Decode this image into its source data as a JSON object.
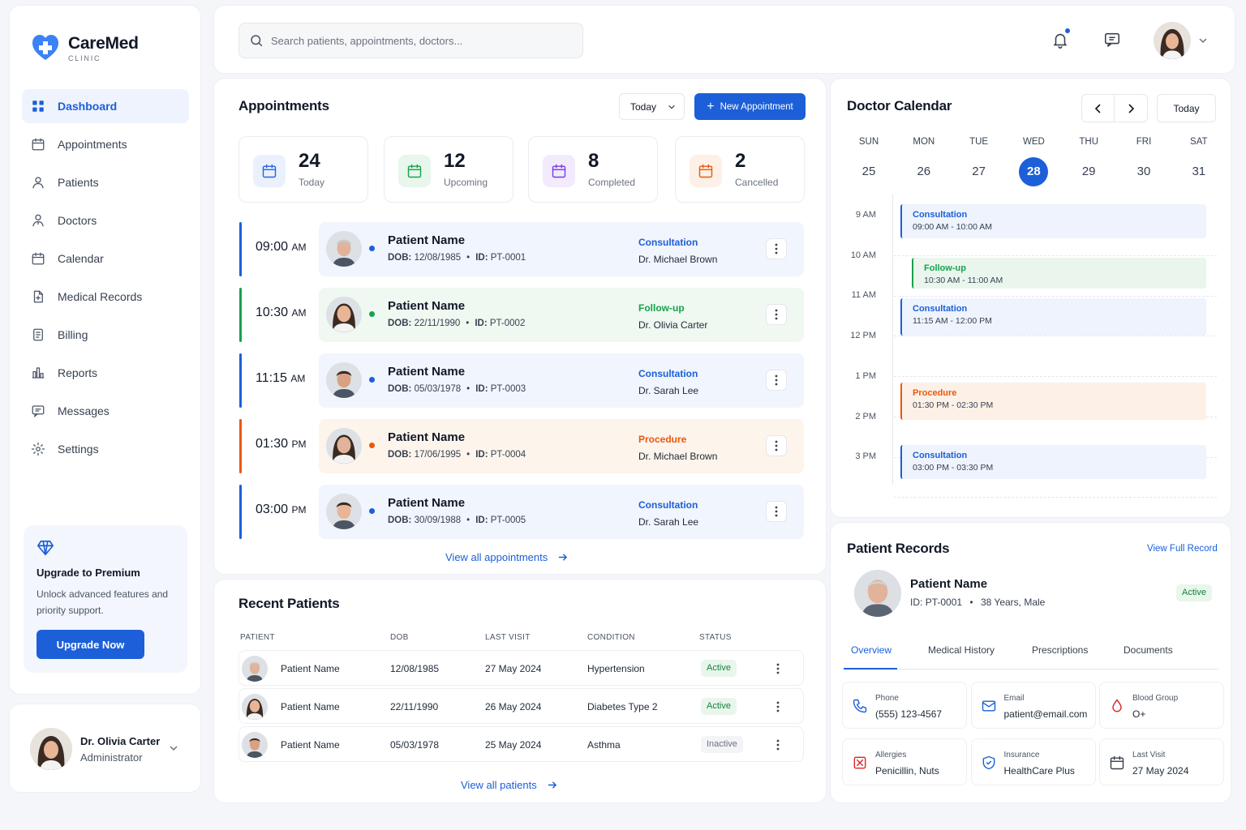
{
  "brand": {
    "name": "CareMed",
    "sub": "CLINIC"
  },
  "nav": [
    {
      "label": "Dashboard",
      "icon": "grid-icon"
    },
    {
      "label": "Appointments",
      "icon": "calendar-icon"
    },
    {
      "label": "Patients",
      "icon": "user-icon"
    },
    {
      "label": "Doctors",
      "icon": "doctor-icon"
    },
    {
      "label": "Calendar",
      "icon": "calendar-icon"
    },
    {
      "label": "Medical Records",
      "icon": "file-icon"
    },
    {
      "label": "Billing",
      "icon": "receipt-icon"
    },
    {
      "label": "Reports",
      "icon": "chart-icon"
    },
    {
      "label": "Messages",
      "icon": "message-icon"
    },
    {
      "label": "Settings",
      "icon": "gear-icon"
    }
  ],
  "promo": {
    "title": "Upgrade to Premium",
    "text": "Unlock advanced features and priority support.",
    "button": "Upgrade Now"
  },
  "profile": {
    "name": "Dr. Olivia Carter",
    "role": "Administrator"
  },
  "search": {
    "placeholder": "Search patients, appointments, doctors..."
  },
  "appointments": {
    "title": "Appointments",
    "filter": "Today",
    "new_button": "New Appointment",
    "stats": [
      {
        "value": "24",
        "label": "Today",
        "color": "#2563eb",
        "bg": "#eaf1fd"
      },
      {
        "value": "12",
        "label": "Upcoming",
        "color": "#16a34a",
        "bg": "#e8f6ec"
      },
      {
        "value": "8",
        "label": "Completed",
        "color": "#7c3aed",
        "bg": "#f1ebfd"
      },
      {
        "value": "2",
        "label": "Cancelled",
        "color": "#ea580c",
        "bg": "#fdf0e7"
      }
    ],
    "list": [
      {
        "time": "09:00",
        "ampm": "AM",
        "name": "Patient Name",
        "dob_label": "DOB:",
        "dob": "12/08/1985",
        "id_label": "ID:",
        "id": "PT-0001",
        "type": "Consultation",
        "doctor": "Dr. Michael Brown",
        "accent": "#1c5fd8",
        "bg": "#f1f5fd"
      },
      {
        "time": "10:30",
        "ampm": "AM",
        "name": "Patient Name",
        "dob_label": "DOB:",
        "dob": "22/11/1990",
        "id_label": "ID:",
        "id": "PT-0002",
        "type": "Follow-up",
        "doctor": "Dr. Olivia Carter",
        "accent": "#16a34a",
        "bg": "#eff8f1"
      },
      {
        "time": "11:15",
        "ampm": "AM",
        "name": "Patient Name",
        "dob_label": "DOB:",
        "dob": "05/03/1978",
        "id_label": "ID:",
        "id": "PT-0003",
        "type": "Consultation",
        "doctor": "Dr. Sarah Lee",
        "accent": "#1c5fd8",
        "bg": "#f1f5fd"
      },
      {
        "time": "01:30",
        "ampm": "PM",
        "name": "Patient Name",
        "dob_label": "DOB:",
        "dob": "17/06/1995",
        "id_label": "ID:",
        "id": "PT-0004",
        "type": "Procedure",
        "doctor": "Dr. Michael Brown",
        "accent": "#ea580c",
        "bg": "#fdf4ec"
      },
      {
        "time": "03:00",
        "ampm": "PM",
        "name": "Patient Name",
        "dob_label": "DOB:",
        "dob": "30/09/1988",
        "id_label": "ID:",
        "id": "PT-0005",
        "type": "Consultation",
        "doctor": "Dr. Sarah Lee",
        "accent": "#1c5fd8",
        "bg": "#f1f5fd"
      }
    ],
    "view_all": "View all appointments"
  },
  "recent": {
    "title": "Recent Patients",
    "headers": [
      "PATIENT",
      "DOB",
      "LAST VISIT",
      "CONDITION",
      "STATUS"
    ],
    "rows": [
      {
        "name": "Patient Name",
        "dob": "12/08/1985",
        "last_visit": "27 May 2024",
        "condition": "Hypertension",
        "status": "Active"
      },
      {
        "name": "Patient Name",
        "dob": "22/11/1990",
        "last_visit": "26 May 2024",
        "condition": "Diabetes Type 2",
        "status": "Active"
      },
      {
        "name": "Patient Name",
        "dob": "05/03/1978",
        "last_visit": "25 May 2024",
        "condition": "Asthma",
        "status": "Inactive"
      }
    ],
    "view_all": "View all patients"
  },
  "calendar": {
    "title": "Doctor Calendar",
    "today": "Today",
    "days": [
      {
        "name": "SUN",
        "num": "25"
      },
      {
        "name": "MON",
        "num": "26"
      },
      {
        "name": "TUE",
        "num": "27"
      },
      {
        "name": "WED",
        "num": "28",
        "selected": true
      },
      {
        "name": "THU",
        "num": "29"
      },
      {
        "name": "FRI",
        "num": "30"
      },
      {
        "name": "SAT",
        "num": "31"
      }
    ],
    "hours": [
      "9 AM",
      "10 AM",
      "11 AM",
      "12 PM",
      "1 PM",
      "2 PM",
      "3 PM"
    ],
    "events": [
      {
        "title": "Consultation",
        "time": "09:00 AM - 10:00 AM",
        "color": "#1c5fd8",
        "bg": "#eef3fd"
      },
      {
        "title": "Follow-up",
        "time": "10:30 AM - 11:00 AM",
        "color": "#16a34a",
        "bg": "#eaf6ed"
      },
      {
        "title": "Consultation",
        "time": "11:15 AM - 12:00 PM",
        "color": "#1c5fd8",
        "bg": "#eef3fd"
      },
      {
        "title": "Procedure",
        "time": "01:30 PM - 02:30 PM",
        "color": "#ea580c",
        "bg": "#fdf1e7"
      },
      {
        "title": "Consultation",
        "time": "03:00 PM - 03:30 PM",
        "color": "#1c5fd8",
        "bg": "#eef3fd"
      }
    ]
  },
  "records": {
    "title": "Patient Records",
    "view_full": "View Full Record",
    "patient": {
      "name": "Patient Name",
      "id_label": "ID:",
      "id": "PT-0001",
      "details": "38 Years, Male",
      "status": "Active"
    },
    "tabs": [
      "Overview",
      "Medical History",
      "Prescriptions",
      "Documents"
    ],
    "info": [
      {
        "label": "Phone",
        "value": "(555) 123-4567",
        "icon": "phone-icon",
        "color": "#1c5fd8"
      },
      {
        "label": "Email",
        "value": "patient@email.com",
        "icon": "mail-icon",
        "color": "#1c5fd8"
      },
      {
        "label": "Blood Group",
        "value": "O+",
        "icon": "drop-icon",
        "color": "#dc2626"
      },
      {
        "label": "Allergies",
        "value": "Penicillin, Nuts",
        "icon": "allergy-icon",
        "color": "#dc2626"
      },
      {
        "label": "Insurance",
        "value": "HealthCare Plus",
        "icon": "shield-icon",
        "color": "#1c5fd8"
      },
      {
        "label": "Last Visit",
        "value": "27 May 2024",
        "icon": "calendar-icon",
        "color": "#374151"
      }
    ]
  }
}
